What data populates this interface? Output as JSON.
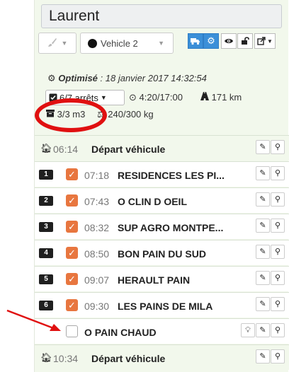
{
  "route": {
    "name": "Laurent",
    "vehicle_label": "Vehicle 2",
    "optimized_label": "Optimisé",
    "optimized_date": ": 18 janvier 2017 14:32:54",
    "stops_count": "6/7 arrêts",
    "time": "4:20/17:00",
    "distance": "171 km",
    "volume": "3/3 m3",
    "weight": "240/300 kg"
  },
  "rows": [
    {
      "type": "depart",
      "time": "06:14",
      "label": "Départ véhicule"
    },
    {
      "type": "stop",
      "num": "1",
      "time": "07:18",
      "label": "RESIDENCES LES PI..."
    },
    {
      "type": "stop",
      "num": "2",
      "time": "07:43",
      "label": "O CLIN D OEIL"
    },
    {
      "type": "stop",
      "num": "3",
      "time": "08:32",
      "label": "SUP AGRO MONTPE..."
    },
    {
      "type": "stop",
      "num": "4",
      "time": "08:50",
      "label": "BON PAIN DU SUD"
    },
    {
      "type": "stop",
      "num": "5",
      "time": "09:07",
      "label": "HERAULT PAIN"
    },
    {
      "type": "stop",
      "num": "6",
      "time": "09:30",
      "label": "LES PAINS DE MILA"
    },
    {
      "type": "unplanned",
      "label": "O PAIN CHAUD"
    },
    {
      "type": "depart",
      "time": "10:34",
      "label": "Départ véhicule"
    }
  ],
  "icons": {
    "brush": "paint-brush-icon",
    "truck": "truck-icon",
    "gear": "gear-icon",
    "eye": "eye-icon",
    "lock": "unlock-icon",
    "share": "share-icon",
    "pencil": "pencil-icon",
    "marker": "map-marker-icon",
    "bulb": "lightbulb-icon",
    "home": "home-icon"
  },
  "colors": {
    "accent_blue": "#3b8fd8",
    "panel_bg": "#f2f8ec",
    "checkbox_orange": "#e8763f",
    "annotation_red": "#e01010"
  }
}
